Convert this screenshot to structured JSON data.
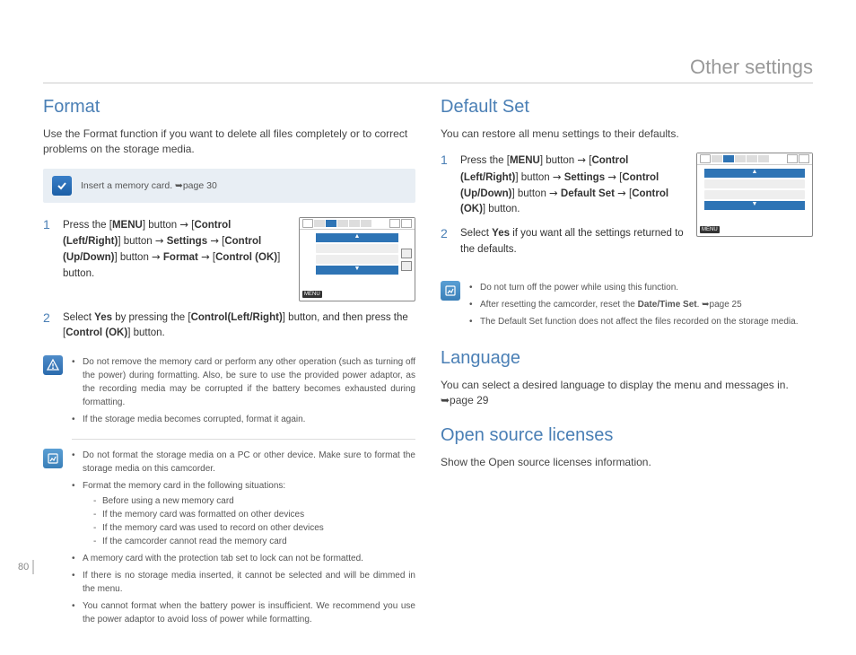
{
  "header": {
    "title": "Other settings"
  },
  "pageNumber": "80",
  "left": {
    "format": {
      "heading": "Format",
      "intro": "Use the Format function if you want to delete all files completely or to correct problems on the storage media.",
      "noteBar": "Insert a memory card. ➥page 30",
      "step1": "Press the [MENU] button → [Control (Left/Right)] button → Settings → [Control (Up/Down)] button → Format → [Control (OK)] button.",
      "step2": "Select Yes by pressing the [Control(Left/Right)] button, and then press the [Control (OK)] button.",
      "warnList": [
        "Do not remove the memory card or perform any other operation (such as turning off the power) during formatting. Also, be sure to use the provided power adaptor, as the recording media may be corrupted if the battery becomes exhausted during formatting.",
        "If the storage media becomes corrupted, format it again."
      ],
      "noteList": {
        "a": "Do not format the storage media on a PC or other device. Make sure to format the storage media on this camcorder.",
        "b": "Format the memory card in the following situations:",
        "bsub": [
          "Before using a new memory card",
          "If the memory card was formatted on other devices",
          "If the memory card was used to record on other devices",
          "If the camcorder cannot read the memory card"
        ],
        "c": "A memory card with the protection tab set to lock can not be formatted.",
        "d": "If there is no storage media inserted, it cannot be selected and will be dimmed in the menu.",
        "e": "You cannot format when the battery power is insufficient. We recommend you use the power adaptor to avoid loss of power while formatting."
      }
    }
  },
  "right": {
    "defaultSet": {
      "heading": "Default Set",
      "intro": "You can restore all menu settings to their defaults.",
      "step1": "Press the [MENU] button → [Control (Left/Right)] button → Settings → [Control (Up/Down)] button → Default Set → [Control (OK)] button.",
      "step2": "Select Yes if you want all the settings returned to the defaults.",
      "noteList": [
        "Do not turn off the power while using this function.",
        "After resetting the camcorder, reset the Date/Time Set. ➥page 25",
        "The Default Set function does not affect the files recorded on the storage media."
      ]
    },
    "language": {
      "heading": "Language",
      "intro": "You can select a desired language to display the menu and messages in. ➥page 29"
    },
    "openSource": {
      "heading": "Open source licenses",
      "intro": "Show the Open source licenses information."
    }
  },
  "thumb": {
    "menuLabel": "MENU"
  }
}
